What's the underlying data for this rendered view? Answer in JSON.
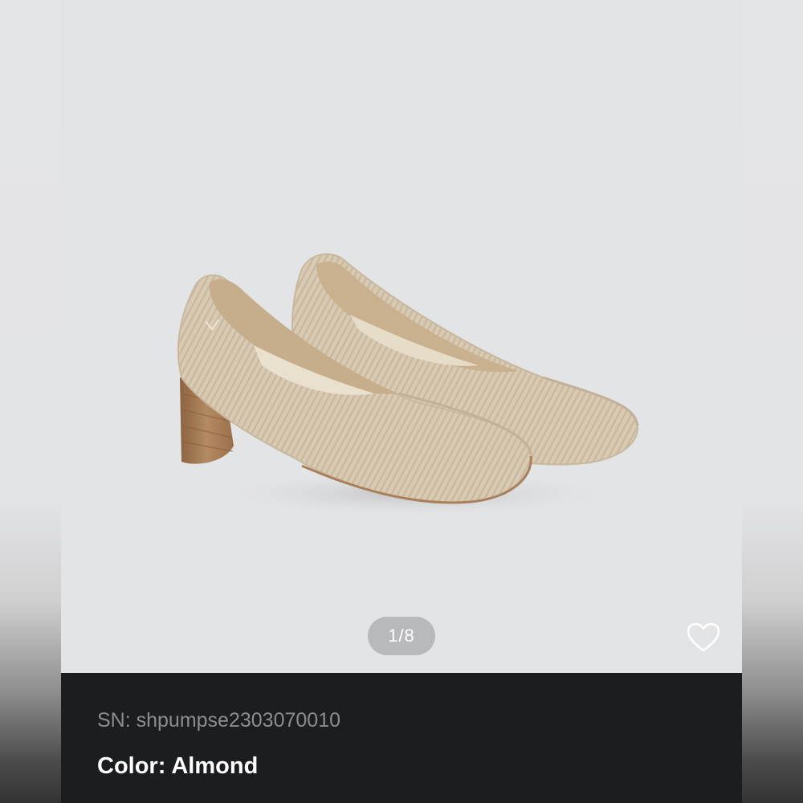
{
  "gallery": {
    "counter": "1/8",
    "image_subject": "almond-knit-block-heel-pumps",
    "favorite_icon": "heart-outline-icon"
  },
  "product": {
    "sn": "SN: shpumpse2303070010",
    "color": "Color: Almond"
  },
  "colors": {
    "photo_background": "#e3e4e6",
    "info_background": "#1c1d1e",
    "shoe_knit": "#d9cbb4",
    "heel_wood": "#a9805b"
  }
}
